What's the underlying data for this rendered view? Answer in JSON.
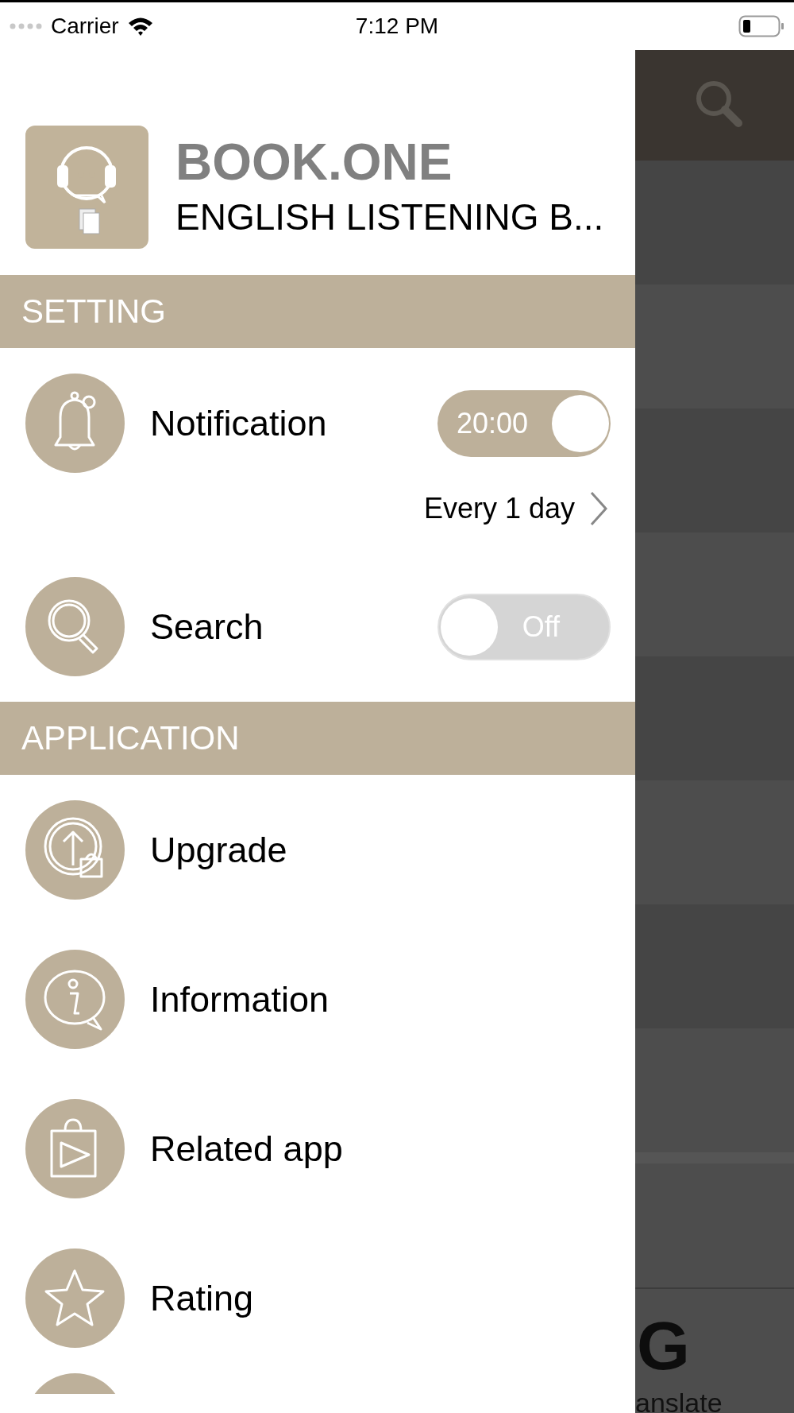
{
  "status_bar": {
    "carrier": "Carrier",
    "time": "7:12 PM"
  },
  "drawer": {
    "app_title": "BOOK.ONE",
    "app_subtitle": "ENGLISH LISTENING B...",
    "sections": [
      {
        "title": "SETTING",
        "items": [
          {
            "kind": "toggle",
            "label": "Notification",
            "on": true,
            "toggle_text": "20:00",
            "detail": "Every 1 day"
          },
          {
            "kind": "toggle",
            "label": "Search",
            "on": false,
            "toggle_text": "Off"
          }
        ]
      },
      {
        "title": "APPLICATION",
        "items": [
          {
            "kind": "link",
            "label": "Upgrade"
          },
          {
            "kind": "link",
            "label": "Information"
          },
          {
            "kind": "link",
            "label": "Related app"
          },
          {
            "kind": "link",
            "label": "Rating"
          }
        ]
      }
    ]
  },
  "background_screen": {
    "logo_letter": "G",
    "tab_label": "anslate"
  }
}
